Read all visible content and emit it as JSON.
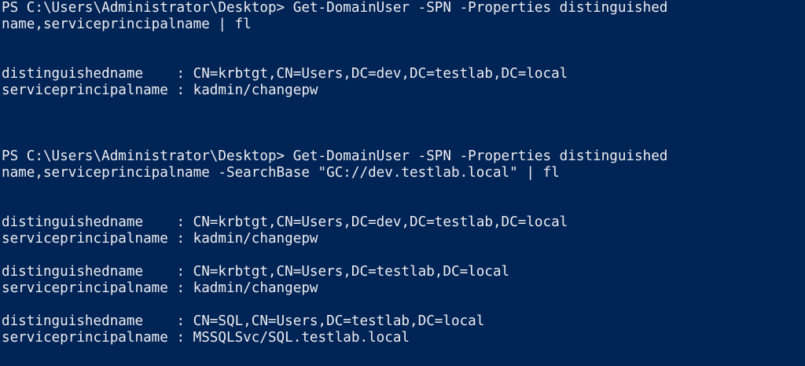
{
  "console": {
    "background": "#012456",
    "foreground": "#eeedf0",
    "lines": [
      "PS C:\\Users\\Administrator\\Desktop> Get-DomainUser -SPN -Properties distinguished",
      "name,serviceprincipalname | fl",
      "",
      "",
      "distinguishedname    : CN=krbtgt,CN=Users,DC=dev,DC=testlab,DC=local",
      "serviceprincipalname : kadmin/changepw",
      "",
      "",
      "",
      "PS C:\\Users\\Administrator\\Desktop> Get-DomainUser -SPN -Properties distinguished",
      "name,serviceprincipalname -SearchBase \"GC://dev.testlab.local\" | fl",
      "",
      "",
      "distinguishedname    : CN=krbtgt,CN=Users,DC=dev,DC=testlab,DC=local",
      "serviceprincipalname : kadmin/changepw",
      "",
      "distinguishedname    : CN=krbtgt,CN=Users,DC=testlab,DC=local",
      "serviceprincipalname : kadmin/changepw",
      "",
      "distinguishedname    : CN=SQL,CN=Users,DC=testlab,DC=local",
      "serviceprincipalname : MSSQLSvc/SQL.testlab.local"
    ]
  }
}
